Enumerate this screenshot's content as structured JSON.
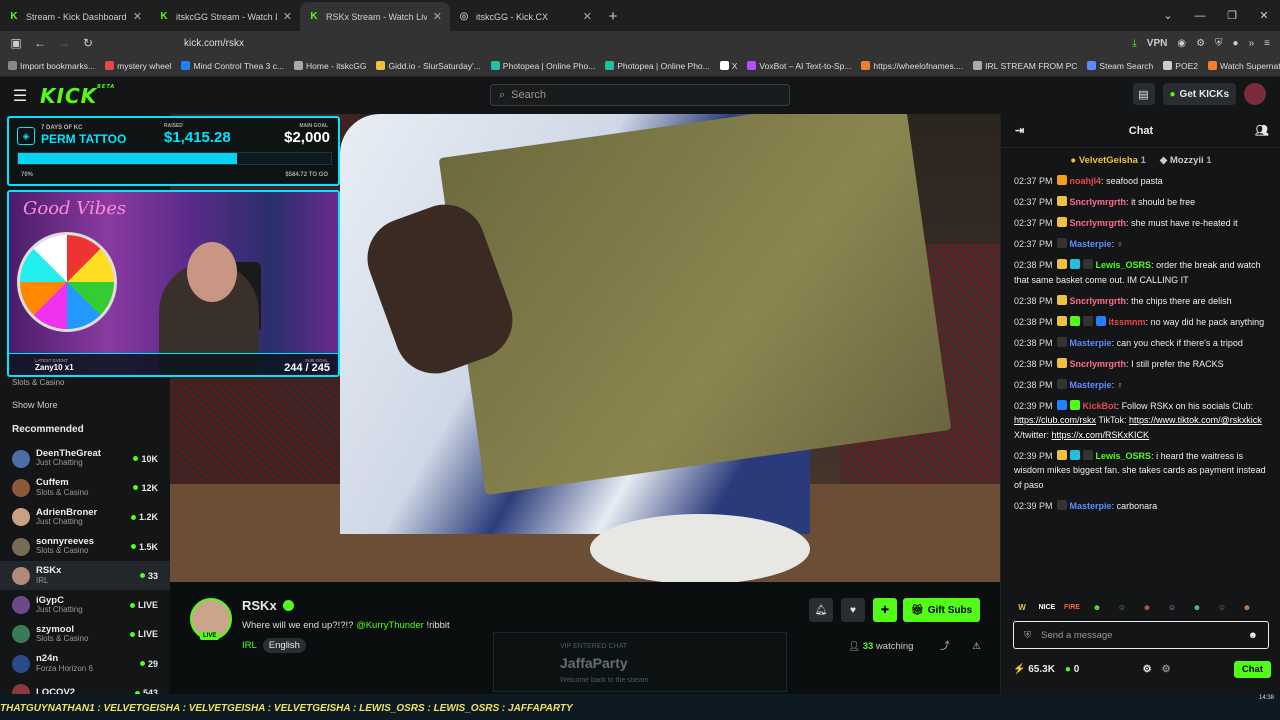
{
  "browser": {
    "tabs": [
      {
        "title": "Stream - Kick Dashboard",
        "active": false
      },
      {
        "title": "itskcGG Stream - Watch Live on",
        "active": false
      },
      {
        "title": "RSKx Stream - Watch Live o",
        "active": true
      },
      {
        "title": "itskcGG - Kick.CX",
        "active": false
      }
    ],
    "url": "kick.com/rskx",
    "vpn": "VPN",
    "bookmarks": [
      "Import bookmarks...",
      "mystery wheel",
      "Mind Control Thea 3 c...",
      "Home - itskcGG",
      "Gidd.io - SlurSaturday'...",
      "Photopea | Online Pho...",
      "Photopea | Online Pho...",
      "X",
      "VoxBot – AI Text-to-Sp...",
      "https://wheelofnames....",
      "IRL STREAM FROM PC",
      "Steam Search",
      "POE2",
      "Watch Supernatural - ..."
    ]
  },
  "header": {
    "logo": "KICK",
    "beta": "BETA",
    "search_placeholder": "Search",
    "get_kicks": "Get KICKs"
  },
  "sidebar": {
    "partial_category": "Slots & Casino",
    "show_more": "Show More",
    "recommended_title": "Recommended",
    "recommended": [
      {
        "name": "DeenTheGreat",
        "category": "Just Chatting",
        "count": "10K"
      },
      {
        "name": "Cuffem",
        "category": "Slots & Casino",
        "count": "12K"
      },
      {
        "name": "AdrienBroner",
        "category": "Just Chatting",
        "count": "1.2K"
      },
      {
        "name": "sonnyreeves",
        "category": "Slots & Casino",
        "count": "1.5K"
      },
      {
        "name": "RSKx",
        "category": "IRL",
        "count": "33"
      },
      {
        "name": "iGypC",
        "category": "Just Chatting",
        "count": "LIVE"
      },
      {
        "name": "szymool",
        "category": "Slots & Casino",
        "count": "LIVE"
      },
      {
        "name": "n24n",
        "category": "Forza Horizon 6",
        "count": "29"
      },
      {
        "name": "LOCOV2",
        "category": "",
        "count": "543"
      }
    ]
  },
  "overlay": {
    "goal_sub": "7 DAYS OF KC",
    "goal_title": "PERM TATTOO",
    "raised_label": "RAISED",
    "raised": "$1,415.28",
    "main_goal_label": "MAIN GOAL",
    "main_goal": "$2,000",
    "progress_pct": "70%",
    "progress": 0.7,
    "remaining": "$584.72 TO GO",
    "cam_text": "Good Vibes",
    "latest_event_label": "LATEST EVENT",
    "latest_event": "Zany10 x1",
    "sub_goal_label": "SUB GOAL",
    "sub_goal": "244 / 245"
  },
  "stream": {
    "streamer": "RSKx",
    "title": "Where will we end up?!?!?",
    "mention": "@KurryThunder",
    "title_tail": "!ribbit",
    "category": "IRL",
    "language": "English",
    "watching_count": "33",
    "watching_label": "watching",
    "gift_subs": "Gift Subs",
    "live": "LIVE",
    "vip_label": "VIP ENTERED CHAT",
    "vip_name": "JaffaParty",
    "vip_msg": "Welcome back to the stream"
  },
  "chat": {
    "title": "Chat",
    "pinned": [
      {
        "name": "VelvetGeisha",
        "count": "1"
      },
      {
        "name": "Mozzyii",
        "count": "1"
      }
    ],
    "messages": [
      {
        "time": "02:37 PM",
        "user": "noahjl4",
        "color": "#e5484d",
        "badges": [
          "#f0a020"
        ],
        "text": "seafood pasta"
      },
      {
        "time": "02:37 PM",
        "user": "Sncrlymrgrth",
        "color": "#ff6b8a",
        "badges": [
          "#f0c040"
        ],
        "text": "it should be free"
      },
      {
        "time": "02:37 PM",
        "user": "Sncrlymrgrth",
        "color": "#ff6b8a",
        "badges": [
          "#f0c040"
        ],
        "text": "she must have re-heated it"
      },
      {
        "time": "02:37 PM",
        "user": "Masterpie",
        "color": "#5b8cff",
        "badges": [
          "#333"
        ],
        "text": ""
      },
      {
        "time": "02:38 PM",
        "user": "Lewis_OSRS",
        "color": "#53fc18",
        "badges": [
          "#f0c040",
          "#20c0e0",
          "#333"
        ],
        "text": "order the break and watch that same basket come out. IM CALLING IT"
      },
      {
        "time": "02:38 PM",
        "user": "Sncrlymrgrth",
        "color": "#ff6b8a",
        "badges": [
          "#f0c040"
        ],
        "text": "the chips there are delish"
      },
      {
        "time": "02:38 PM",
        "user": "itssmnm",
        "color": "#e5484d",
        "badges": [
          "#f0c040",
          "#53fc18",
          "#333",
          "#2080ff"
        ],
        "text": "no way did he pack anything"
      },
      {
        "time": "02:38 PM",
        "user": "Masterpie",
        "color": "#5b8cff",
        "badges": [
          "#333"
        ],
        "text": "can you check if there's a tripod"
      },
      {
        "time": "02:38 PM",
        "user": "Sncrlymrgrth",
        "color": "#ff6b8a",
        "badges": [
          "#f0c040"
        ],
        "text": "I still prefer the RACKS"
      },
      {
        "time": "02:38 PM",
        "user": "Masterpie",
        "color": "#5b8cff",
        "badges": [
          "#333"
        ],
        "text": ""
      },
      {
        "time": "02:39 PM",
        "user": "KickBot",
        "color": "#e5484d",
        "badges": [
          "#2080ff",
          "#53fc18"
        ],
        "text": "Follow RSKx on his socials Club: https://club.com/rskx TikTok: https://www.tiktok.com/@rskxkick X/twitter: https://x.com/RSKxKICK"
      },
      {
        "time": "02:39 PM",
        "user": "Lewis_OSRS",
        "color": "#53fc18",
        "badges": [
          "#f0c040",
          "#20c0e0",
          "#333"
        ],
        "text": "i heard the waitress is wisdom mikes biggest fan. she takes cards as payment instead of paso"
      },
      {
        "time": "02:39 PM",
        "user": "Masterpie",
        "color": "#5b8cff",
        "badges": [
          "#333"
        ],
        "text": "carbonara"
      }
    ],
    "emotes": [
      "W",
      "NICE",
      "FIRE"
    ],
    "input_placeholder": "Send a message",
    "kicks_count": "65.3K",
    "points": "0",
    "send_label": "Chat"
  },
  "taskbar": {
    "ticker": "THATGUYNATHAN1 : VELVETGEISHA : VELVETGEISHA : VELVETGEISHA : LEWIS_OSRS : LEWIS_OSRS : JAFFAPARTY",
    "time": "14:38"
  }
}
